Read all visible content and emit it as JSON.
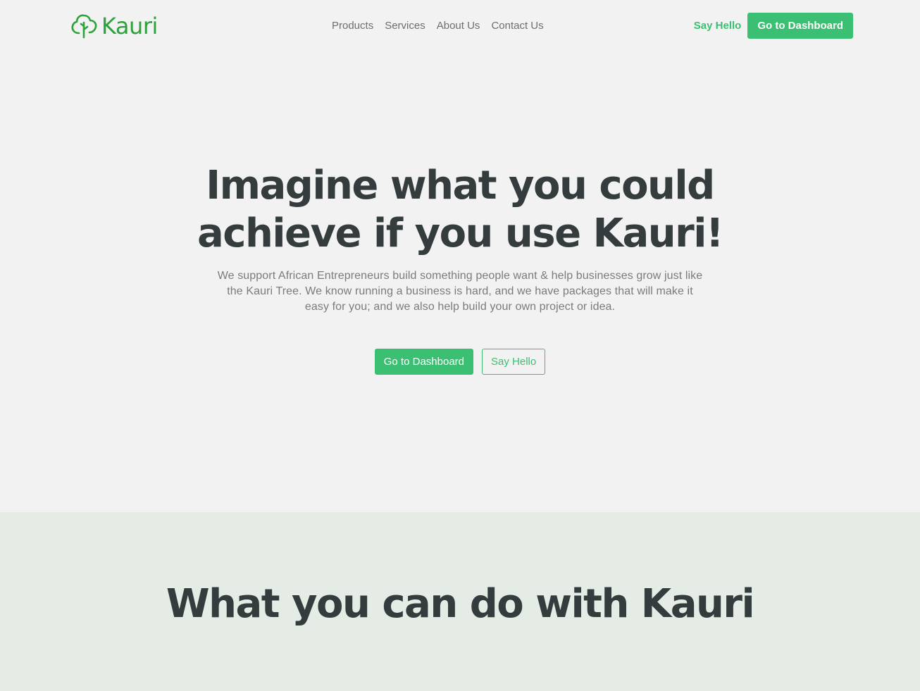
{
  "brand": {
    "name": "Kauri",
    "icon": "tree-icon",
    "color": "#2da23a"
  },
  "nav": {
    "links": [
      "Products",
      "Services",
      "About Us",
      "Contact Us"
    ],
    "say_hello": "Say Hello",
    "dashboard": "Go to Dashboard"
  },
  "hero": {
    "title": "Imagine what you could achieve if you use Kauri!",
    "subtitle": "We support African Entrepreneurs build something people want & help businesses grow just like the Kauri Tree. We know running a business is hard, and we have packages that will make it easy for you; and we also help build your own project or idea.",
    "primary_cta": "Go to Dashboard",
    "secondary_cta": "Say Hello"
  },
  "features": {
    "title": "What you can do with Kauri"
  },
  "colors": {
    "accent": "#3bbf72",
    "text_dark": "#353c3e",
    "page_bg": "#f2f2f2",
    "section_bg": "#e5ece6"
  }
}
